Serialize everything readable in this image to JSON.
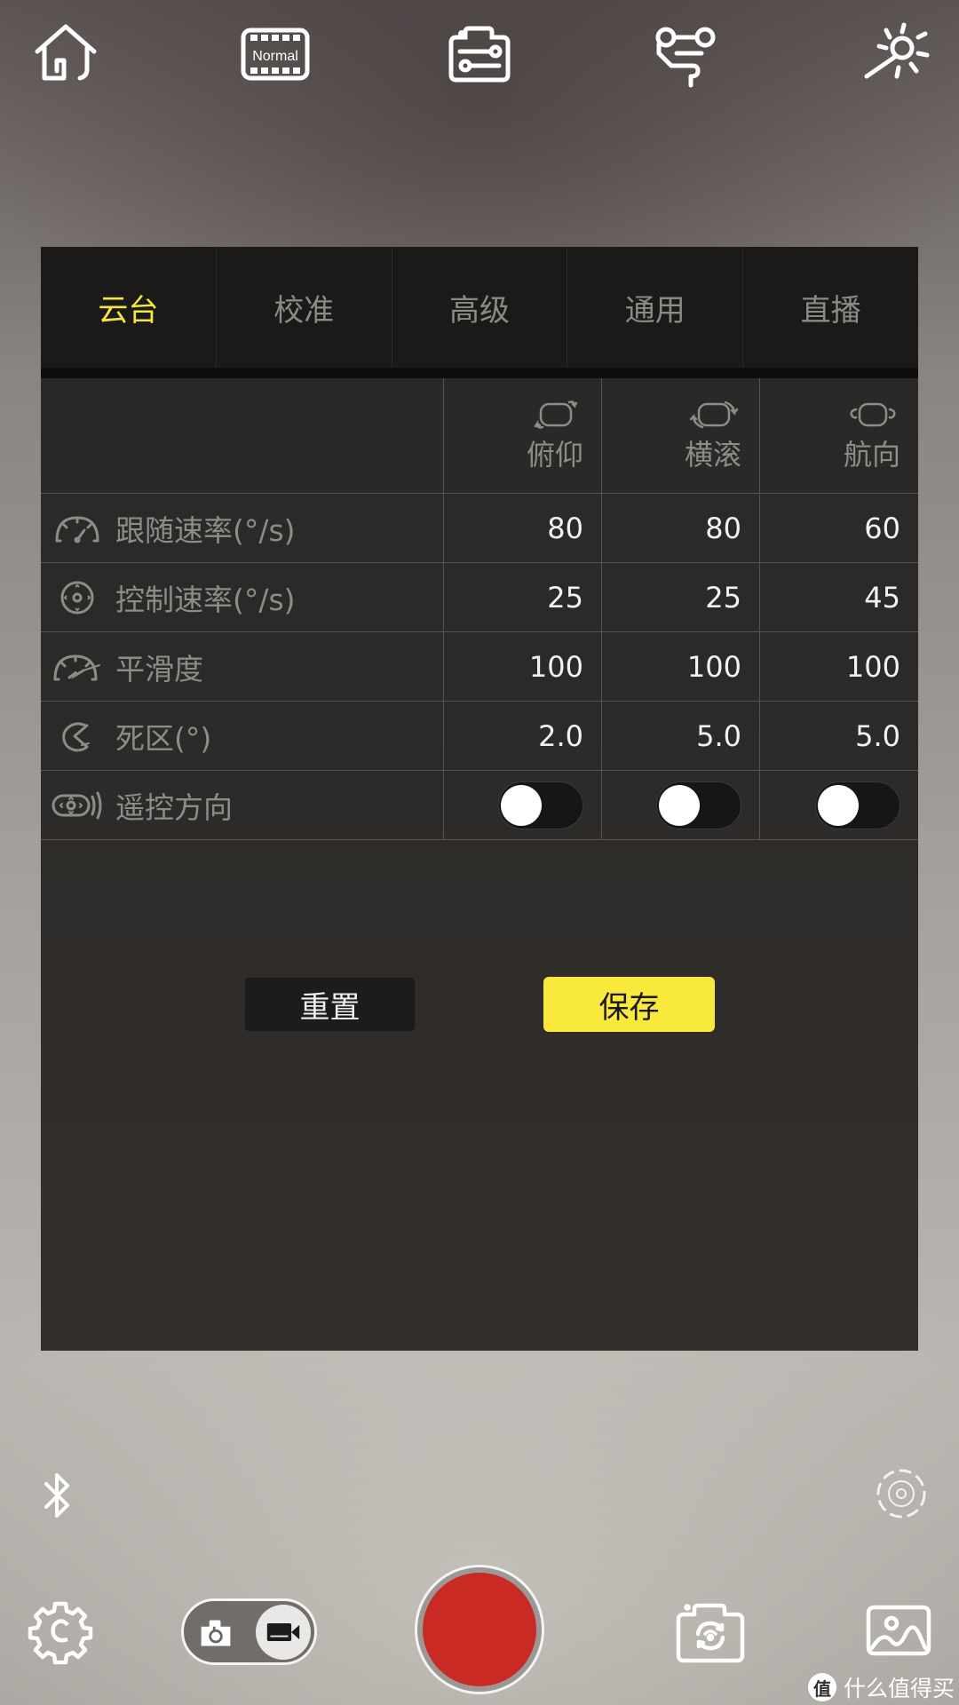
{
  "toolbar": {
    "home_icon": "home-icon",
    "mode_badge": "Normal",
    "settings_sliders_icon": "camera-settings-sliders-icon",
    "path_icon": "timelapse-path-icon",
    "brightness_icon": "brightness-wand-icon"
  },
  "tabs": [
    {
      "label": "云台",
      "active": true
    },
    {
      "label": "校准",
      "active": false
    },
    {
      "label": "高级",
      "active": false
    },
    {
      "label": "通用",
      "active": false
    },
    {
      "label": "直播",
      "active": false
    }
  ],
  "table": {
    "columns": [
      {
        "label": "俯仰",
        "icon": "pitch-axis-icon"
      },
      {
        "label": "横滚",
        "icon": "roll-axis-icon"
      },
      {
        "label": "航向",
        "icon": "pan-axis-icon"
      }
    ],
    "rows": [
      {
        "label": "跟随速率(°/s)",
        "icon": "gauge-icon",
        "values": [
          "80",
          "80",
          "60"
        ]
      },
      {
        "label": "控制速率(°/s)",
        "icon": "joystick-icon",
        "values": [
          "25",
          "25",
          "45"
        ]
      },
      {
        "label": "平滑度",
        "icon": "smooth-gauge-icon",
        "values": [
          "100",
          "100",
          "100"
        ]
      },
      {
        "label": "死区(°)",
        "icon": "deadzone-icon",
        "values": [
          "2.0",
          "5.0",
          "5.0"
        ]
      },
      {
        "label": "遥控方向",
        "icon": "remote-direction-icon",
        "toggles": [
          false,
          false,
          false
        ]
      }
    ]
  },
  "buttons": {
    "reset": "重置",
    "save": "保存"
  },
  "colors": {
    "accent_yellow": "#f5e63c",
    "record_red": "#c92a24",
    "panel_bg": "#2b2928"
  },
  "bottom": {
    "bluetooth_icon": "bluetooth-icon",
    "target_icon": "focus-target-icon",
    "settings_icon": "gear-icon",
    "mode_switch": {
      "options": [
        "photo",
        "video"
      ],
      "selected": "video"
    },
    "record_button": "record",
    "flip_camera_icon": "flip-camera-icon",
    "gallery_icon": "gallery-icon"
  },
  "watermark": {
    "badge": "值",
    "text": "什么值得买"
  }
}
